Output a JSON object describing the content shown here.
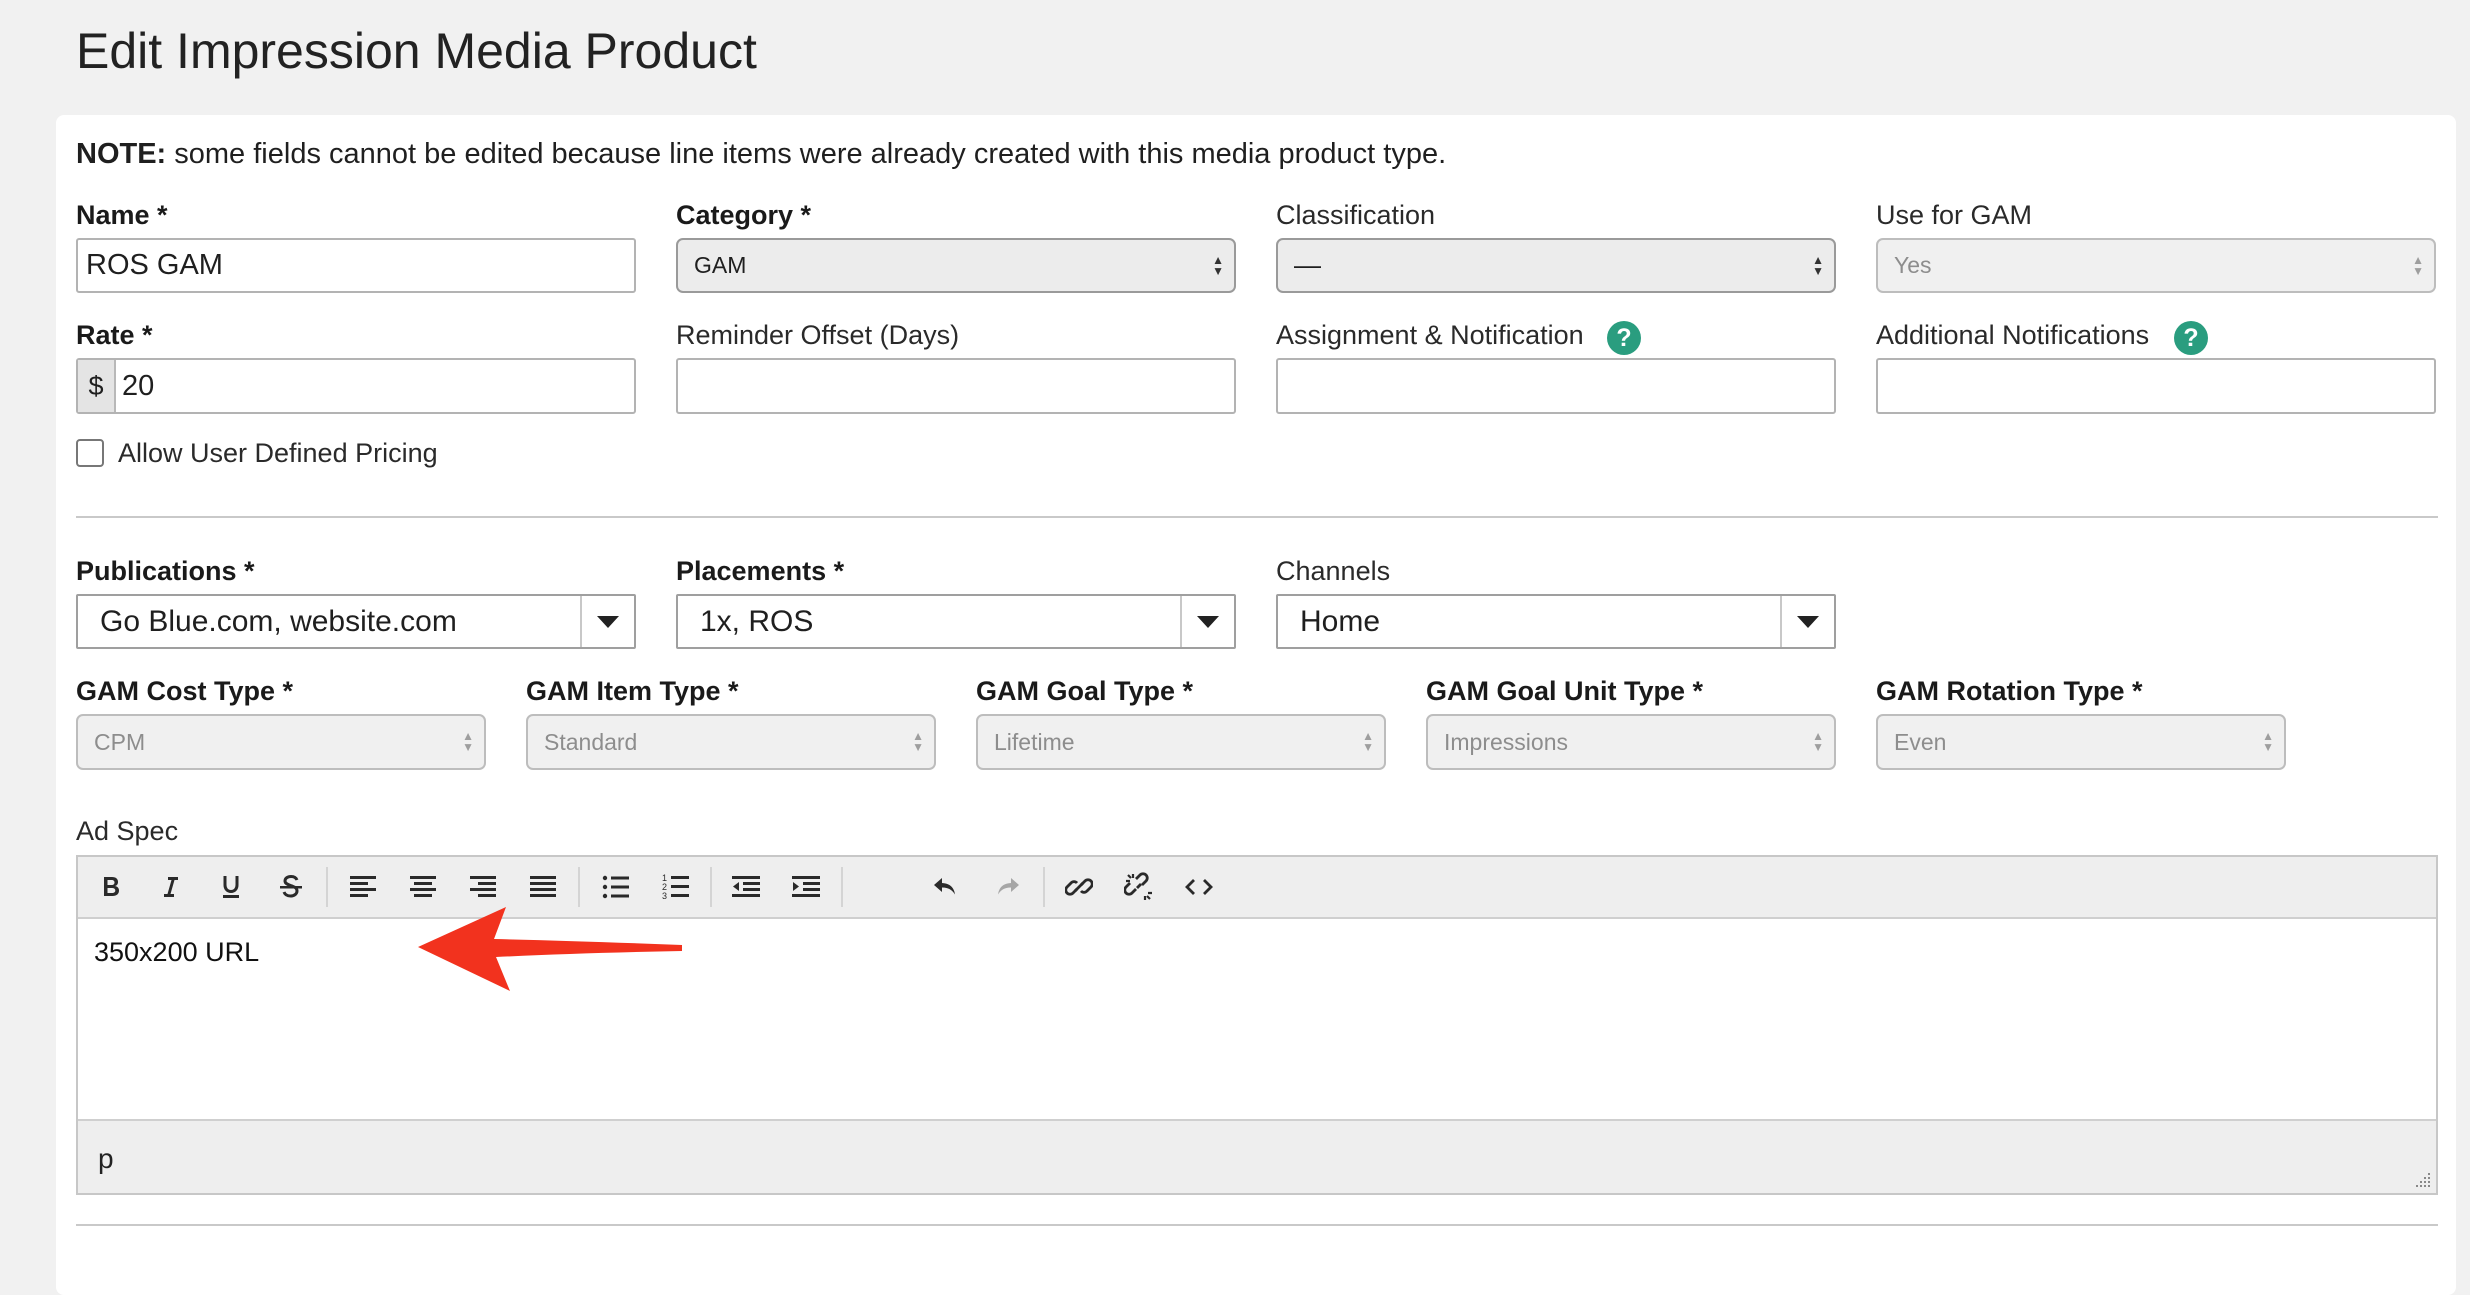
{
  "page": {
    "title": "Edit Impression Media Product"
  },
  "note": {
    "prefix": "NOTE:",
    "text": " some fields cannot be edited because line items were already created with this media product type."
  },
  "fields": {
    "name": {
      "label": "Name *",
      "value": "ROS GAM"
    },
    "category": {
      "label": "Category *",
      "value": "GAM"
    },
    "classification": {
      "label": "Classification",
      "value": "—"
    },
    "use_for_gam": {
      "label": "Use for GAM",
      "value": "Yes"
    },
    "rate": {
      "label": "Rate *",
      "prefix": "$",
      "value": "20"
    },
    "reminder_offset": {
      "label": "Reminder Offset (Days)",
      "value": ""
    },
    "assignment": {
      "label": "Assignment & Notification",
      "value": ""
    },
    "additional": {
      "label": "Additional Notifications",
      "value": ""
    },
    "allow_pricing": {
      "label": "Allow User Defined Pricing",
      "checked": false
    },
    "publications": {
      "label": "Publications *",
      "value": "Go Blue.com, website.com"
    },
    "placements": {
      "label": "Placements *",
      "value": "1x, ROS"
    },
    "channels": {
      "label": "Channels",
      "value": "Home"
    },
    "gam_cost_type": {
      "label": "GAM Cost Type *",
      "value": "CPM"
    },
    "gam_item_type": {
      "label": "GAM Item Type *",
      "value": "Standard"
    },
    "gam_goal_type": {
      "label": "GAM Goal Type *",
      "value": "Lifetime"
    },
    "gam_goal_unit_type": {
      "label": "GAM Goal Unit Type *",
      "value": "Impressions"
    },
    "gam_rotation_type": {
      "label": "GAM Rotation Type *",
      "value": "Even"
    }
  },
  "ad_spec": {
    "label": "Ad Spec",
    "content": "350x200 URL",
    "status_path": "p",
    "toolbar_icons": [
      "bold-icon",
      "italic-icon",
      "underline-icon",
      "strikethrough-icon",
      "align-left-icon",
      "align-center-icon",
      "align-right-icon",
      "align-justify-icon",
      "bullet-list-icon",
      "numbered-list-icon",
      "outdent-icon",
      "indent-icon",
      "undo-icon",
      "redo-icon",
      "link-icon",
      "unlink-icon",
      "code-icon"
    ]
  },
  "colors": {
    "help": "#2a9d7f",
    "annotation_arrow": "#f2321e"
  },
  "help_icon": {
    "symbol": "?"
  }
}
